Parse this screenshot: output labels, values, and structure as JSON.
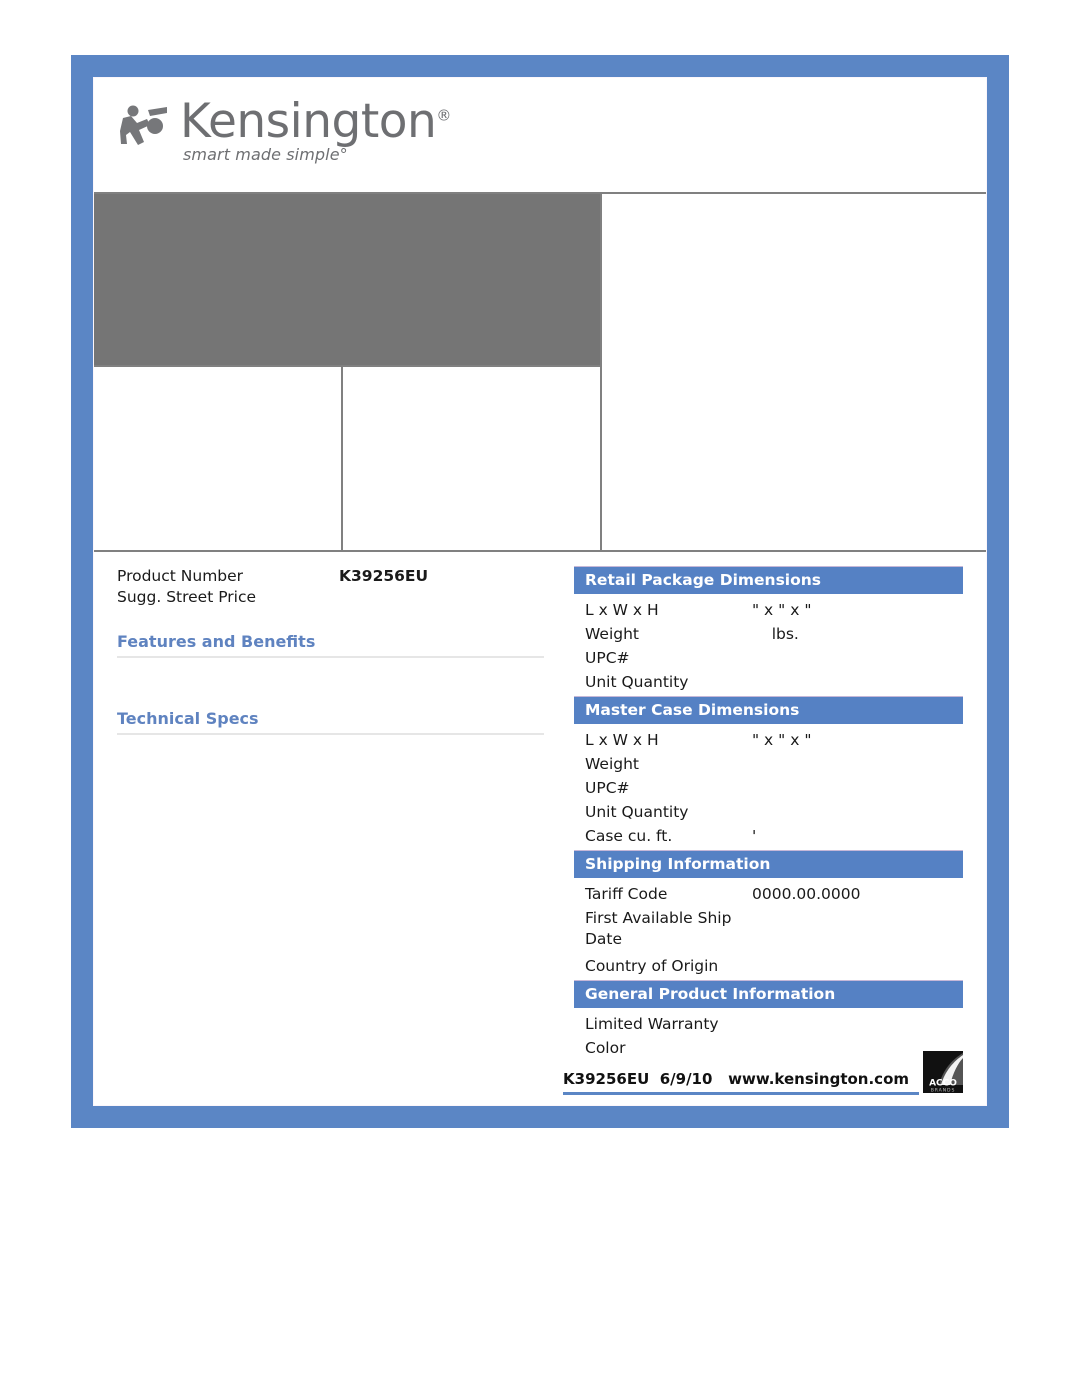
{
  "brand": {
    "wordmark": "Kensington",
    "registered_mark": "®",
    "tagline": "smart made simple°",
    "logo_icon": "kensington-figure-icon"
  },
  "product": {
    "number_label": "Product Number",
    "number_value": "K39256EU",
    "price_label": "Sugg. Street Price",
    "price_value": ""
  },
  "left_sections": [
    {
      "title": "Features and Benefits",
      "body": ""
    },
    {
      "title": "Technical Specs",
      "body": ""
    }
  ],
  "spec_sections": [
    {
      "title": "Retail Package Dimensions",
      "rows": [
        {
          "key": "L x W x H",
          "value": "\" x \" x \"",
          "wrapped": false
        },
        {
          "key": "Weight",
          "value": "    lbs.",
          "wrapped": false
        },
        {
          "key": "UPC#",
          "value": "",
          "wrapped": false
        },
        {
          "key": "Unit Quantity",
          "value": "",
          "wrapped": false
        }
      ]
    },
    {
      "title": "Master Case Dimensions",
      "rows": [
        {
          "key": "L x W x H",
          "value": "\" x \" x \"",
          "wrapped": false
        },
        {
          "key": "Weight",
          "value": "",
          "wrapped": false
        },
        {
          "key": "UPC#",
          "value": "",
          "wrapped": false
        },
        {
          "key": "Unit Quantity",
          "value": "",
          "wrapped": false
        },
        {
          "key": "Case cu. ft.",
          "value": "'",
          "wrapped": false
        }
      ]
    },
    {
      "title": "Shipping Information",
      "rows": [
        {
          "key": "Tariff Code",
          "value": "0000.00.0000",
          "wrapped": false
        },
        {
          "key": "First Available Ship Date",
          "value": "",
          "wrapped": true
        },
        {
          "key": "Country of Origin",
          "value": "",
          "wrapped": false
        }
      ]
    },
    {
      "title": "General Product Information",
      "rows": [
        {
          "key": "Limited Warranty",
          "value": "",
          "wrapped": false
        },
        {
          "key": "Color",
          "value": "",
          "wrapped": false
        }
      ]
    }
  ],
  "footer": {
    "text": "K39256EU  6/9/10   www.kensington.com",
    "acco_logo_top": "ACCO",
    "acco_logo_bottom": "BRANDS"
  },
  "colors": {
    "frame_blue": "#5b86c5",
    "header_blue": "#5581c4",
    "heading_blue": "#5f83c0",
    "placeholder_gray": "#757575",
    "rule_gray": "#808080"
  }
}
